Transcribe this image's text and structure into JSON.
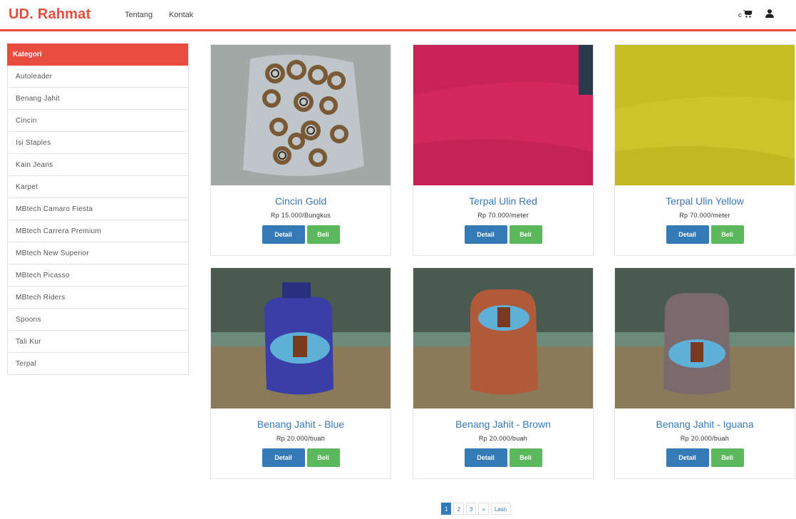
{
  "navbar": {
    "brand": "UD. Rahmat",
    "links": [
      "Tentang",
      "Kontak"
    ],
    "cart_count": "c",
    "accent_color": "#e84c3d"
  },
  "sidebar": {
    "header": "Kategori",
    "items": [
      "Autoleader",
      "Benang Jahit",
      "Cincin",
      "Isi Staples",
      "Kain Jeans",
      "Karpet",
      "MBtech Camaro Fiesta",
      "MBtech Carrera Premium",
      "MBtech New Superior",
      "MBtech Picasso",
      "MBtech Riders",
      "Spoons",
      "Tali Kur",
      "Terpal"
    ]
  },
  "products": [
    {
      "name": "Cincin Gold",
      "price": "Rp 15.000/Bungkus",
      "detail": "Detail",
      "buy": "Beli"
    },
    {
      "name": "Terpal Ulin Red",
      "price": "Rp 70.000/meter",
      "detail": "Detail",
      "buy": "Beli"
    },
    {
      "name": "Terpal Ulin Yellow",
      "price": "Rp 70.000/meter",
      "detail": "Detail",
      "buy": "Beli"
    },
    {
      "name": "Benang Jahit - Blue",
      "price": "Rp 20.000/buah",
      "detail": "Detail",
      "buy": "Beli"
    },
    {
      "name": "Benang Jahit - Brown",
      "price": "Rp 20.000/buah",
      "detail": "Detail",
      "buy": "Beli"
    },
    {
      "name": "Benang Jahit - Iguana",
      "price": "Rp 20.000/buah",
      "detail": "Detail",
      "buy": "Beli"
    }
  ],
  "pagination": {
    "pages": [
      "1",
      "2",
      "3",
      "»",
      "Last›"
    ],
    "active": "1"
  }
}
